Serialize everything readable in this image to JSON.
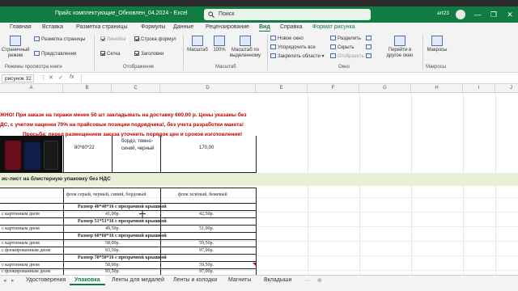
{
  "window": {
    "title": "Прайс комплектующие_Обновлен_04.2024  -  Excel",
    "search_placeholder": "Поиск",
    "user": "art23",
    "close_symbol": "✕",
    "restore_symbol": "❐",
    "minimize_symbol": "—"
  },
  "ribbon_tabs": [
    "Главная",
    "Вставка",
    "Разметка страницы",
    "Формулы",
    "Данные",
    "Рецензирование",
    "Вид",
    "Справка",
    "Формат рисунка"
  ],
  "active_tab": "Вид",
  "ribbon": {
    "book_views": {
      "label": "Режимы просмотра книги",
      "page_mode": "Страничный режим",
      "page_layout": "Разметка страницы",
      "custom_views": "Представления"
    },
    "show": {
      "label": "Отображение",
      "ruler": "Линейка",
      "formula_bar": "Строка формул",
      "grid": "Сетка",
      "headings": "Заголовки"
    },
    "zoom": {
      "label": "Масштаб",
      "zoom": "Масштаб",
      "percent": "100%",
      "to_selection": "Масштаб по выделенному"
    },
    "window": {
      "label": "Окно",
      "new_window": "Новое окно",
      "arrange_all": "Упорядочить все",
      "freeze_panes": "Закрепить области",
      "split": "Разделить",
      "hide": "Скрыть",
      "unhide": "Отобразить",
      "switch_windows": "Перейти в другое окно"
    },
    "macros": {
      "label": "Макросы",
      "macros": "Макросы"
    }
  },
  "formula_bar": {
    "name_box": "рисунок 32",
    "fx": "fx",
    "value": ""
  },
  "columns": [
    "A",
    "B",
    "C",
    "D",
    "E",
    "F",
    "G",
    "H",
    "I",
    "J"
  ],
  "notice": {
    "line1": "ЖНО! При заказе на тиражи менее 50 шт закладывать на доставку 600,00 р. Цены указаны без",
    "line2": "ДС, с учетом наценки 70% на прайсовые позиции подрядчика!, без учета разработки макета!",
    "line3": "Просьба: перед размещением заказа уточнить порядок цен и сроков изготовления!"
  },
  "product_row": {
    "size": "80*80*22",
    "colors_line1": "бордо, темно-",
    "colors_line2": "синий, черный",
    "price": "170,00"
  },
  "section_title": "ис-лист на блистерную упаковку без НДС",
  "price_table": {
    "header_b": "флок  серый, черный, синий,  бордовый",
    "header_d": "флок  зелёный, бежевый",
    "groups": [
      {
        "title": "Размер 40*40*16 с прозрачной крышкой",
        "rows": [
          {
            "label": "с картонным дном",
            "price_b": "41,00р.",
            "price_d": "42,50р."
          }
        ]
      },
      {
        "title": "Размер 51*51*16 с прозрачной крышкой",
        "rows": [
          {
            "label": "с картонным дном",
            "price_b": "49,50р.",
            "price_d": "51,00р."
          }
        ]
      },
      {
        "title": "Размер 60*60*16 с прозрачной крышкой",
        "rows": [
          {
            "label": "с картонным дном",
            "price_b": "58,00р.",
            "price_d": "59,50р."
          },
          {
            "label": "с флокированным дном",
            "price_b": "93,50р.",
            "price_d": "97,00р."
          }
        ]
      },
      {
        "title": "Размер 70*50*16 с прозрачной крышкой",
        "rows": [
          {
            "label": "с картонным дном",
            "price_b": "58,00р.",
            "price_d": "59,50р."
          },
          {
            "label": "с флокированным дном",
            "price_b": "93,50р.",
            "price_d": "97,00р."
          }
        ]
      }
    ]
  },
  "sheet_tabs": [
    "Удостоверения",
    "Упаковка",
    "Ленты для медалей",
    "Ленты и колодки",
    "Магниты",
    "Вкладыши"
  ],
  "active_sheet": "Упаковка",
  "colors": {
    "brand_green": "#107c41",
    "notice_red": "#c00000",
    "section_band": "#e8f0d8"
  }
}
